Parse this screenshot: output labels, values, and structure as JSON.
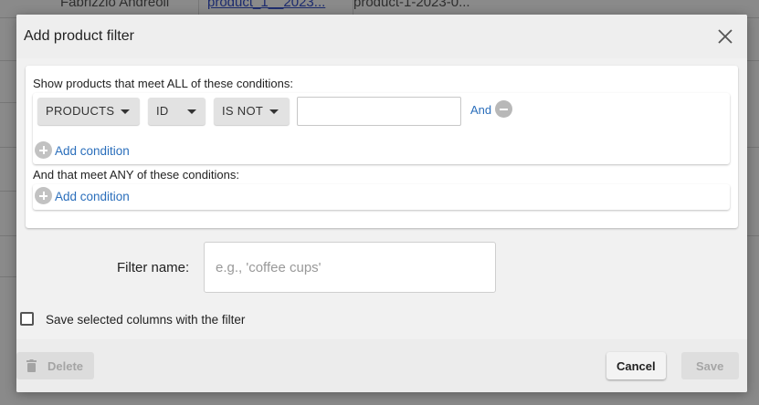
{
  "background": {
    "row": [
      "Fabrizzio Andreoli",
      "product_1__2023...",
      "product-1-2023-0..."
    ]
  },
  "dialog": {
    "title": "Add product filter",
    "all_section": {
      "label": "Show products that meet ALL of these conditions:",
      "condition": {
        "field_group": "PRODUCTS",
        "field": "ID",
        "operator": "IS NOT",
        "value": ""
      },
      "and_link": "And",
      "add_condition": "Add condition"
    },
    "any_section": {
      "label": "And that meet ANY of these conditions:",
      "add_condition": "Add condition"
    },
    "filter_name": {
      "label": "Filter name:",
      "placeholder": "e.g., 'coffee cups'",
      "value": ""
    },
    "save_columns": {
      "label": "Save selected columns with the filter",
      "checked": false
    },
    "buttons": {
      "delete": "Delete",
      "cancel": "Cancel",
      "save": "Save"
    }
  },
  "icons": {
    "close": "close-icon",
    "caret": "caret-down-icon",
    "remove": "minus-circle-icon",
    "add": "plus-circle-icon",
    "delete": "trash-icon"
  },
  "colors": {
    "link": "#2a6ebb",
    "overlay": "#7b7b7b"
  }
}
